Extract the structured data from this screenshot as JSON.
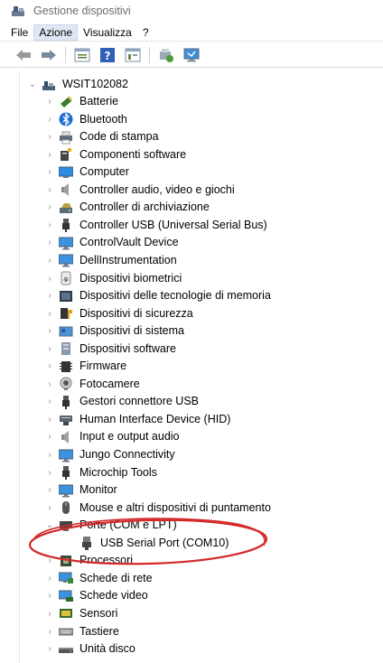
{
  "window": {
    "title": "Gestione dispositivi"
  },
  "menu": [
    {
      "label": "File"
    },
    {
      "label": "Azione"
    },
    {
      "label": "Visualizza"
    },
    {
      "label": "?"
    }
  ],
  "toolbar": {
    "buttons": [
      "back-icon",
      "forward-icon",
      "properties-icon",
      "help-icon",
      "console-tree-icon",
      "update-driver-icon",
      "scan-hardware-icon"
    ]
  },
  "tree": {
    "root": {
      "label": "WSIT102082",
      "expanded": true
    },
    "categories": [
      {
        "label": "Batterie",
        "icon": "battery-icon"
      },
      {
        "label": "Bluetooth",
        "icon": "bluetooth-icon"
      },
      {
        "label": "Code di stampa",
        "icon": "printer-icon"
      },
      {
        "label": "Componenti software",
        "icon": "software-component-icon"
      },
      {
        "label": "Computer",
        "icon": "computer-icon"
      },
      {
        "label": "Controller audio, video e giochi",
        "icon": "speaker-icon"
      },
      {
        "label": "Controller di archiviazione",
        "icon": "storage-controller-icon"
      },
      {
        "label": "Controller USB (Universal Serial Bus)",
        "icon": "usb-icon"
      },
      {
        "label": "ControlVault Device",
        "icon": "monitor-icon"
      },
      {
        "label": "DellInstrumentation",
        "icon": "monitor-icon"
      },
      {
        "label": "Dispositivi biometrici",
        "icon": "fingerprint-icon"
      },
      {
        "label": "Dispositivi delle tecnologie di memoria",
        "icon": "memory-device-icon"
      },
      {
        "label": "Dispositivi di sicurezza",
        "icon": "security-key-icon"
      },
      {
        "label": "Dispositivi di sistema",
        "icon": "system-device-icon"
      },
      {
        "label": "Dispositivi software",
        "icon": "software-device-icon"
      },
      {
        "label": "Firmware",
        "icon": "firmware-chip-icon"
      },
      {
        "label": "Fotocamere",
        "icon": "camera-icon"
      },
      {
        "label": "Gestori connettore USB",
        "icon": "usb-icon"
      },
      {
        "label": "Human Interface Device (HID)",
        "icon": "hid-icon"
      },
      {
        "label": "Input e output audio",
        "icon": "speaker-icon"
      },
      {
        "label": "Jungo Connectivity",
        "icon": "monitor-icon"
      },
      {
        "label": "Microchip Tools",
        "icon": "usb-icon"
      },
      {
        "label": "Monitor",
        "icon": "monitor-icon"
      },
      {
        "label": "Mouse e altri dispositivi di puntamento",
        "icon": "mouse-icon"
      },
      {
        "label": "Porte (COM e LPT)",
        "icon": "port-icon",
        "expanded": true,
        "children": [
          {
            "label": "USB Serial Port (COM10)",
            "icon": "serial-port-icon"
          }
        ]
      },
      {
        "label": "Processori",
        "icon": "processor-icon"
      },
      {
        "label": "Schede di rete",
        "icon": "network-adapter-icon"
      },
      {
        "label": "Schede video",
        "icon": "display-adapter-icon"
      },
      {
        "label": "Sensori",
        "icon": "sensor-icon"
      },
      {
        "label": "Tastiere",
        "icon": "keyboard-icon"
      },
      {
        "label": "Unità disco",
        "icon": "disk-drive-icon"
      }
    ]
  },
  "annotation": {
    "color": "#d42a2a",
    "target": "Porte (COM e LPT)"
  }
}
